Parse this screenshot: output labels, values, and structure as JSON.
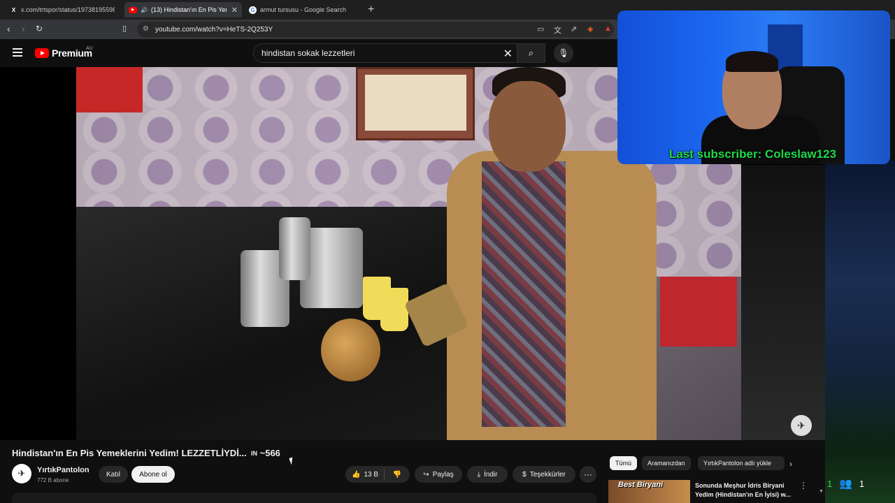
{
  "browser": {
    "tabs": [
      {
        "label": "x.com/trtspor/status/197381955984",
        "icon": "x-logo-icon",
        "active": false
      },
      {
        "label": "(13) Hindistan'ın En Pis Yeme",
        "icon": "youtube-icon",
        "active": true
      },
      {
        "label": "armut tursusu - Google Search",
        "icon": "google-icon",
        "active": false
      }
    ],
    "url": "youtube.com/watch?v=HeTS-2Q253Y"
  },
  "youtube": {
    "logo_text": "Premium",
    "region": "AU",
    "search_value": "hindistan sokak lezzetleri",
    "search_placeholder": "Ara"
  },
  "video": {
    "title": "Hindistan'ın En Pis Yemeklerini Yedim! LEZZETLİYDİ...",
    "title_suffix_mark": "IN",
    "title_suffix": "~566",
    "channel_name": "YırtıkPantolon",
    "subscribers": "772 B abone",
    "join_label": "Katıl",
    "subscribe_label": "Abone ol",
    "likes": "13 B",
    "share_label": "Paylaş",
    "download_label": "İndir",
    "thanks_label": "Teşekkürler",
    "more_label": "···"
  },
  "webcam": {
    "overlay_text": "Last subscriber: Coleslaw123",
    "overlay_color": "#1fd84a"
  },
  "sidebar": {
    "chips": [
      "Tümü",
      "Aramanızdan",
      "YırtıkPantolon adlı yükle"
    ],
    "recommendation": {
      "thumb_text": "Best Biryani",
      "title": "Sonunda Meşhur İdris Biryani Yedim (Hindistan'ın En İyisi) w..."
    }
  },
  "stream": {
    "viewer_count": "1",
    "people_count": "1"
  },
  "colors": {
    "accent_red": "#ff0000",
    "background": "#0f0f0f"
  }
}
